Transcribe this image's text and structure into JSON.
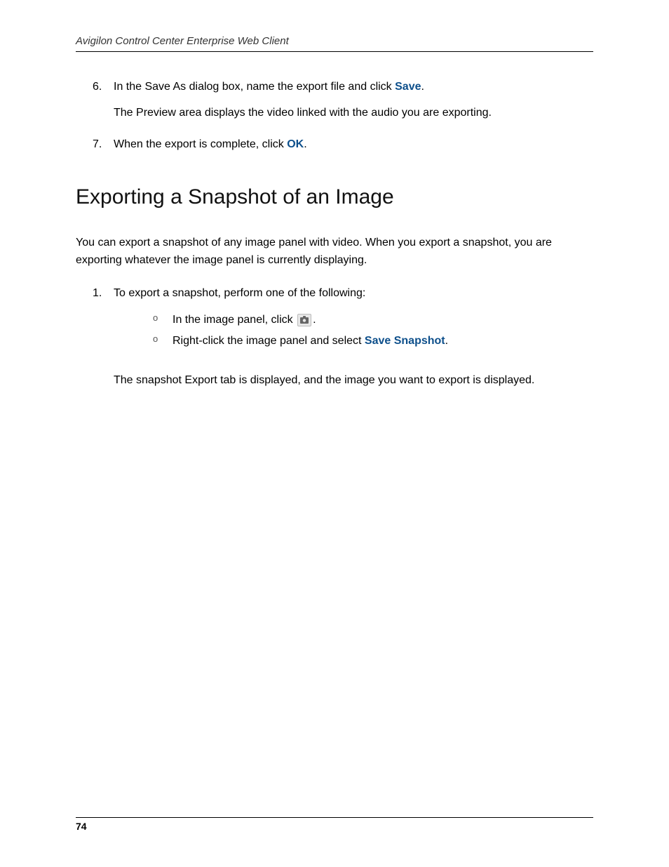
{
  "header": {
    "title": "Avigilon Control Center Enterprise Web Client"
  },
  "upper_steps": [
    {
      "marker": "6.",
      "line_pre": "In the Save As dialog box, name the export file and click ",
      "action": "Save",
      "line_post": ".",
      "para": "The Preview area displays the video linked with the audio you are exporting."
    },
    {
      "marker": "7.",
      "line_pre": "When the export is complete, click ",
      "action": "OK",
      "line_post": "."
    }
  ],
  "section": {
    "title": "Exporting a Snapshot of an Image",
    "intro": "You can export a snapshot of any image panel with video. When you export a snapshot, you are exporting whatever the image panel is currently displaying."
  },
  "lower_step": {
    "marker": "1.",
    "text": "To export a snapshot, perform one of the following:"
  },
  "sub": [
    {
      "marker": "o",
      "pre": "In the image panel, click ",
      "icon": "camera-icon",
      "post": "."
    },
    {
      "marker": "o",
      "pre": "Right-click the image panel and select ",
      "action": "Save Snapshot",
      "post": "."
    }
  ],
  "closing": "The snapshot Export tab is displayed, and the image you want to export is displayed.",
  "footer": {
    "page": "74"
  }
}
